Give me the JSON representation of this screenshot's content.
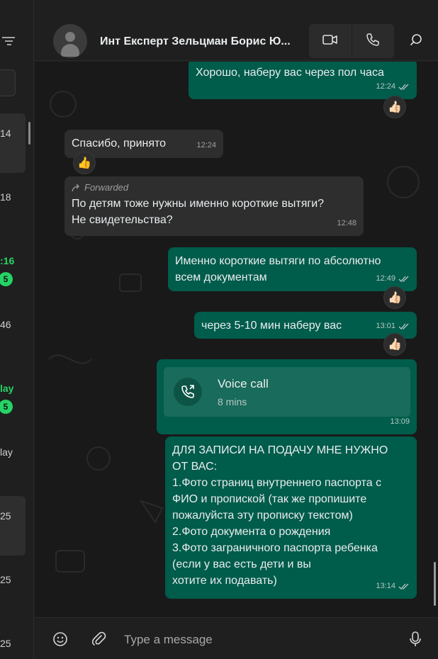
{
  "sidebar": {
    "items": [
      {
        "time": "14",
        "active": true,
        "green": false,
        "badge": ""
      },
      {
        "time": "18",
        "active": false,
        "green": false,
        "badge": ""
      },
      {
        "time": ":16",
        "active": false,
        "green": true,
        "badge": "5"
      },
      {
        "time": "46",
        "active": false,
        "green": false,
        "badge": ""
      },
      {
        "time": "lay",
        "active": false,
        "green": true,
        "badge": "5"
      },
      {
        "time": "lay",
        "active": false,
        "green": false,
        "badge": ""
      },
      {
        "time": "25",
        "active": true,
        "green": false,
        "badge": ""
      },
      {
        "time": "25",
        "active": false,
        "green": false,
        "badge": ""
      },
      {
        "time": "25",
        "active": false,
        "green": false,
        "badge": ""
      }
    ]
  },
  "header": {
    "contact_name": "Инт Експерт Зельцман Борис Ю...",
    "icons": [
      "video-call-icon",
      "voice-call-icon",
      "search-icon"
    ]
  },
  "messages": [
    {
      "dir": "out",
      "text": "Хорошо, наберу вас через пол часа",
      "time": "12:24",
      "reaction": "👍🏻"
    },
    {
      "dir": "in",
      "text": "Спасибо,  принято",
      "time": "12:24",
      "reaction": "👍"
    },
    {
      "dir": "in",
      "forwarded_label": "Forwarded",
      "lines": [
        "По детям тоже нужны именно короткие вытяги?",
        "Не свидетельства?"
      ],
      "time": "12:48"
    },
    {
      "dir": "out",
      "lines": [
        "Именно короткие вытяги по абсолютно",
        "всем документам"
      ],
      "time": "12:49",
      "reaction": "👍🏻"
    },
    {
      "dir": "out",
      "text": "через 5-10 мин наберу вас",
      "time": "13:01",
      "reaction": "👍🏻"
    },
    {
      "dir": "out",
      "type": "call",
      "call_title": "Voice call",
      "call_duration": "8 mins",
      "time": "13:09"
    },
    {
      "dir": "out",
      "lines": [
        "ДЛЯ ЗАПИСИ НА ПОДАЧУ МНЕ НУЖНО",
        "ОТ ВАС:",
        "1.Фото страниц внутреннего паспорта с",
        "ФИО и пропиской (так же пропишите",
        "пожалуйста эту прописку текстом)",
        "2.Фото документа о рождения",
        "3.Фото заграничного паспорта ребенка",
        "(если у вас есть дети и вы",
        "хотите их подавать)"
      ],
      "time": "13:14"
    }
  ],
  "composer": {
    "placeholder": "Type a message"
  },
  "colors": {
    "outgoing_bubble": "#005c4b",
    "incoming_bubble": "#2e2e2e",
    "unread_green": "#25d366"
  }
}
